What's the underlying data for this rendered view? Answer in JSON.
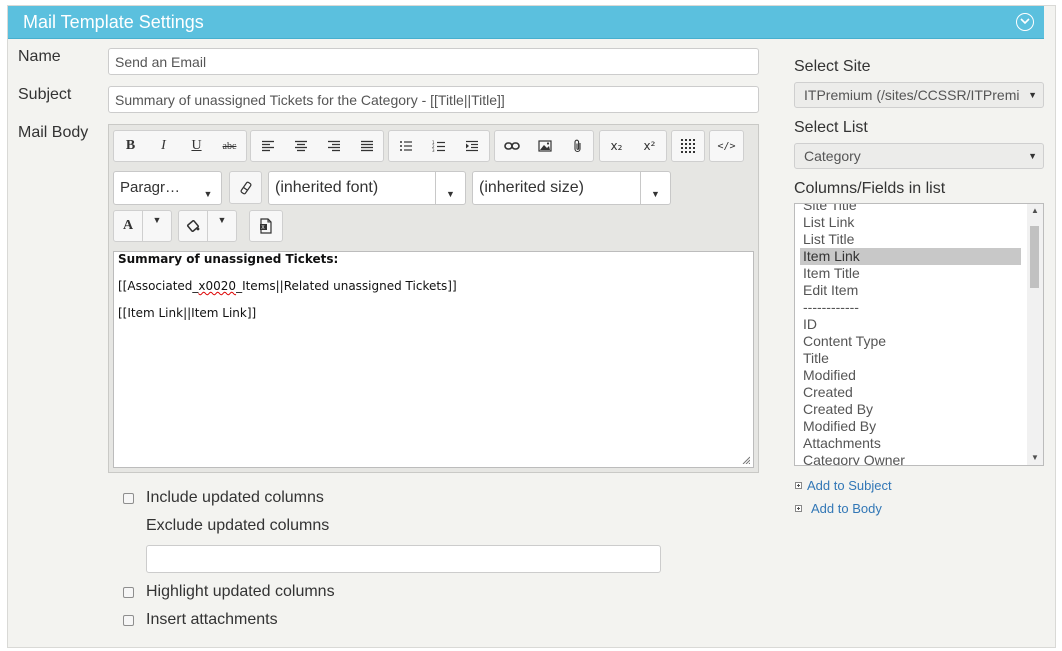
{
  "panel": {
    "title": "Mail Template Settings"
  },
  "form": {
    "name_label": "Name",
    "name_value": "Send an Email",
    "subject_label": "Subject",
    "subject_value": "Summary of unassigned Tickets for the Category - [[Title||Title]]",
    "body_label": "Mail Body"
  },
  "toolbar": {
    "bold": "B",
    "italic": "I",
    "underline": "U",
    "strike": "abc",
    "subscript": "x₂",
    "superscript": "x²",
    "source": "</>",
    "font_color": "A",
    "paragraph": "Paragr…",
    "font": "(inherited font)",
    "size": "(inherited size)"
  },
  "editor": {
    "line1": "Summary of unassigned Tickets:",
    "line2_prefix": "[[Associated_",
    "line2_spell": "x0020",
    "line2_suffix": "_Items||Related unassigned Tickets]]",
    "line3": "[[Item Link||Item Link]]"
  },
  "options": {
    "include_updated": "Include updated columns",
    "exclude_updated": "Exclude updated columns",
    "exclude_value": "",
    "highlight_updated": "Highlight updated columns",
    "insert_attachments": "Insert attachments"
  },
  "sidebar": {
    "site_label": "Select Site",
    "site_value": "ITPremium (/sites/CCSSR/ITPremi",
    "list_label": "Select List",
    "list_value": "Category",
    "columns_label": "Columns/Fields in list",
    "columns": [
      "Site Title",
      "List Link",
      "List Title",
      "Item Link",
      "Item Title",
      "Edit Item",
      "------------",
      "ID",
      "Content Type",
      "Title",
      "Modified",
      "Created",
      "Created By",
      "Modified By",
      "Attachments",
      "Category Owner"
    ],
    "selected_column": "Item Link",
    "add_to_subject": "Add to Subject",
    "add_to_body": "Add to Body"
  },
  "colors": {
    "header": "#5bc0de",
    "link": "#3277b6",
    "selection": "#c8c8c8"
  }
}
